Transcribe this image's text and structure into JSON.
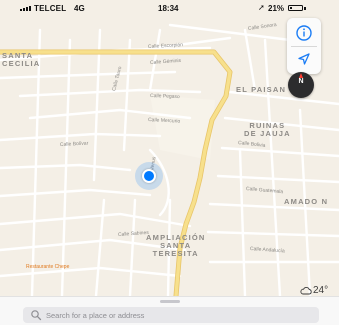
{
  "status_bar": {
    "carrier": "TELCEL",
    "network": "4G",
    "time": "18:34",
    "battery_text": "21%",
    "battery_level": 0.21
  },
  "map": {
    "neighborhoods": [
      {
        "id": "santa-cecilia",
        "text": "SANTA\nCECILIA"
      },
      {
        "id": "el-paisan",
        "text": "EL PAISAN"
      },
      {
        "id": "ruinas-de-jauja",
        "text": "RUINAS\nDE JAUJA"
      },
      {
        "id": "amado-n",
        "text": "AMADO N"
      },
      {
        "id": "ampliacion-santa-teresita",
        "text": "AMPLIACIÓN\nSANTA\nTERESITA"
      }
    ],
    "streets": [
      {
        "id": "calle-sonora",
        "text": "Calle Sonora"
      },
      {
        "id": "calle-escorpion",
        "text": "Calle Escorpión"
      },
      {
        "id": "calle-geminis",
        "text": "Calle Géminis"
      },
      {
        "id": "calle-tauro",
        "text": "Calle Tauro"
      },
      {
        "id": "calle-pegaso",
        "text": "Calle Pegaso"
      },
      {
        "id": "calle-mercurio",
        "text": "Calle Mercurio"
      },
      {
        "id": "calle-bolivia",
        "text": "Calle Bolivia"
      },
      {
        "id": "calle-venus",
        "text": "Calle Venus"
      },
      {
        "id": "calle-guatemala",
        "text": "Calle Guatemala"
      },
      {
        "id": "calle-bolivar",
        "text": "Calle Bolívar"
      },
      {
        "id": "calle-sabines",
        "text": "Calle Sabines"
      },
      {
        "id": "calle-andalucia",
        "text": "Calle Andalucía"
      }
    ],
    "poi": "Restaurante Chepe"
  },
  "controls": {
    "info_icon": "info-icon",
    "tracking_icon": "location-arrow-icon",
    "compass_label": "N",
    "compass_needle_color": "#ff3b30"
  },
  "weather": {
    "icon": "cloud-icon",
    "temperature": "24°"
  },
  "search": {
    "placeholder": "Search for a place or address"
  },
  "colors": {
    "user_location": "#007aff",
    "major_road": "#f7e08c",
    "map_background": "#f4efe6"
  }
}
